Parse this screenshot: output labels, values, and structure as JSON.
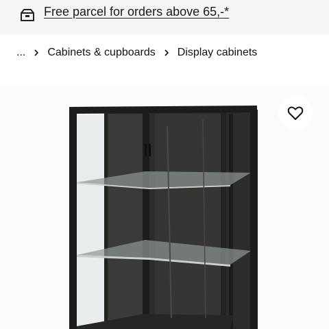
{
  "banner": {
    "icon": "parcel-icon",
    "text": "Free parcel for orders above 65,-*"
  },
  "breadcrumb": {
    "items": [
      "...",
      "Cabinets & cupboards",
      "Display cabinets"
    ],
    "separator_icon": "chevron-right-icon"
  },
  "product": {
    "image": "display-cabinet-image",
    "favourite_icon": "heart-icon",
    "colors": {
      "cabinet": "#1c1c1b",
      "glass": "#8f9796",
      "background": "#fbfbfb"
    }
  }
}
